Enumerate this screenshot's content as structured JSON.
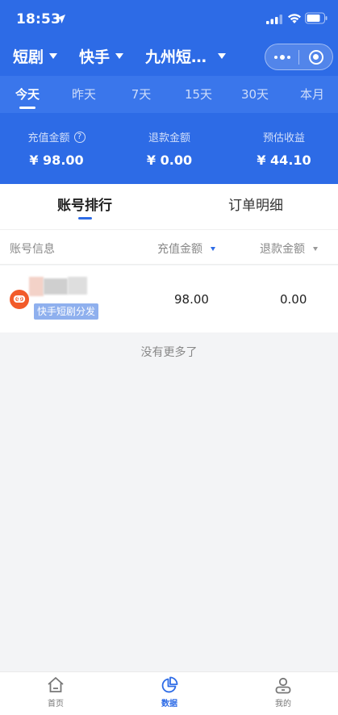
{
  "status_bar": {
    "time": "18:53"
  },
  "filters": [
    {
      "label": "短剧"
    },
    {
      "label": "快手"
    },
    {
      "label": "九州短…"
    }
  ],
  "day_tabs": [
    "今天",
    "昨天",
    "7天",
    "15天",
    "30天",
    "本月"
  ],
  "active_day_tab": "今天",
  "metrics": [
    {
      "label": "充值金额",
      "value": "¥ 98.00",
      "has_help_icon": true
    },
    {
      "label": "退款金额",
      "value": "¥ 0.00"
    },
    {
      "label": "预估收益",
      "value": "¥ 44.10"
    }
  ],
  "sub_tabs": [
    "账号排行",
    "订单明细"
  ],
  "active_sub_tab": "账号排行",
  "table": {
    "headers": [
      "账号信息",
      "充值金额",
      "退款金额"
    ],
    "rows": [
      {
        "tag": "快手短剧分发",
        "recharge": "98.00",
        "refund": "0.00"
      }
    ]
  },
  "no_more_text": "没有更多了",
  "bottom_tabs": [
    {
      "label": "首页",
      "icon": "home-icon"
    },
    {
      "label": "数据",
      "icon": "pie-chart-icon"
    },
    {
      "label": "我的",
      "icon": "user-icon"
    }
  ],
  "active_bottom_tab": "数据",
  "colors": {
    "primary": "#2d6be6",
    "tag_bg": "#8fb0ee",
    "avatar": "#f25b2a"
  }
}
